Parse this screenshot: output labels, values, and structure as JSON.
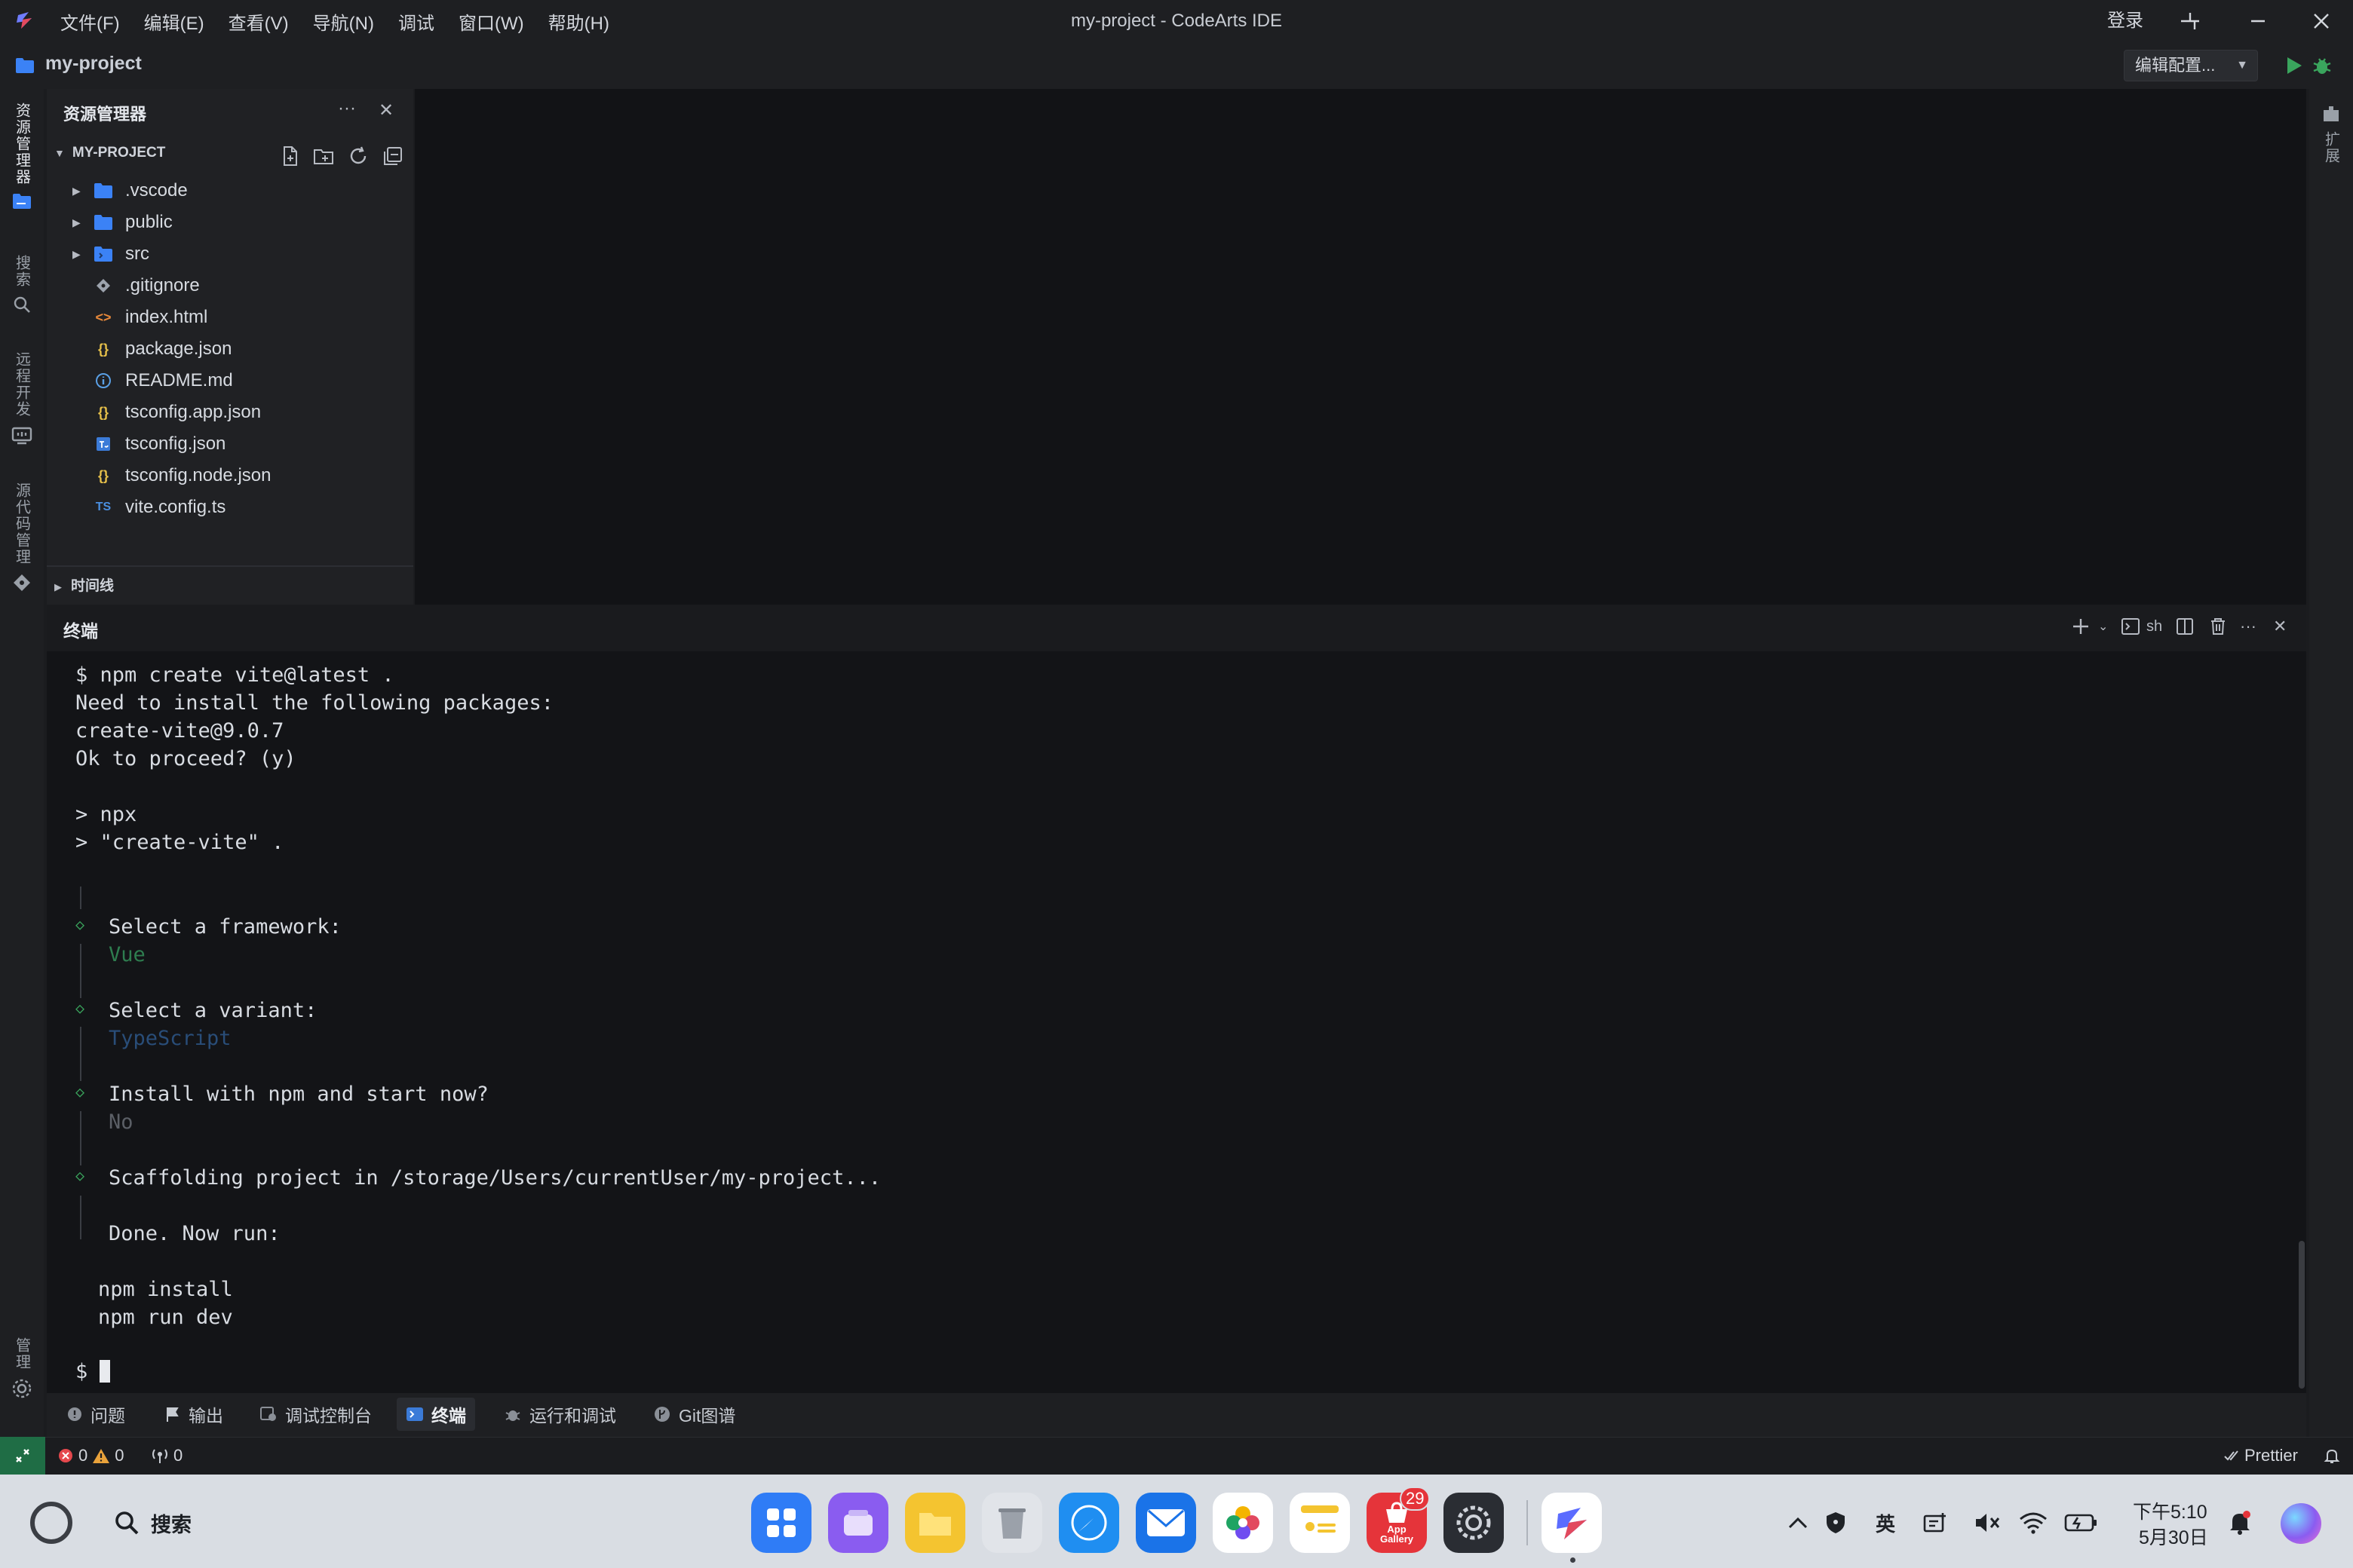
{
  "titlebar": {
    "menu": [
      "文件(F)",
      "编辑(E)",
      "查看(V)",
      "导航(N)",
      "调试",
      "窗口(W)",
      "帮助(H)"
    ],
    "title": "my-project - CodeArts IDE",
    "login": "登录"
  },
  "projectbar": {
    "project_name": "my-project",
    "run_config": "编辑配置..."
  },
  "activity_left": {
    "explorer": "资源管理器",
    "search": "搜索",
    "remote": "远程开发",
    "scm": "源代码管理",
    "manage": "管理"
  },
  "activity_right": {
    "extensions": "扩展"
  },
  "explorer": {
    "title": "资源管理器",
    "project_header": "MY-PROJECT",
    "items": [
      {
        "name": ".vscode",
        "kind": "folder",
        "icon": "folder-icon"
      },
      {
        "name": "public",
        "kind": "folder",
        "icon": "folder-icon"
      },
      {
        "name": "src",
        "kind": "folder",
        "icon": "src-folder-icon"
      },
      {
        "name": ".gitignore",
        "kind": "file",
        "icon": "git-icon"
      },
      {
        "name": "index.html",
        "kind": "file",
        "icon": "html-icon"
      },
      {
        "name": "package.json",
        "kind": "file",
        "icon": "json-icon"
      },
      {
        "name": "README.md",
        "kind": "file",
        "icon": "info-icon"
      },
      {
        "name": "tsconfig.app.json",
        "kind": "file",
        "icon": "json-icon"
      },
      {
        "name": "tsconfig.json",
        "kind": "file",
        "icon": "tsconfig-icon"
      },
      {
        "name": "tsconfig.node.json",
        "kind": "file",
        "icon": "json-icon"
      },
      {
        "name": "vite.config.ts",
        "kind": "file",
        "icon": "ts-icon"
      }
    ],
    "timeline": "时间线"
  },
  "panel": {
    "title": "终端",
    "shell": "sh"
  },
  "terminal": {
    "lines": [
      "$ npm create vite@latest .",
      "Need to install the following packages:",
      "create-vite@9.0.7",
      "Ok to proceed? (y)",
      "> npx",
      "> \"create-vite\" .",
      "Select a framework:",
      "Vue",
      "Select a variant:",
      "TypeScript",
      "Install with npm and start now?",
      "No",
      "Scaffolding project in /storage/Users/currentUser/my-project...",
      "Done. Now run:",
      "npm install",
      "npm run dev",
      "$"
    ]
  },
  "bottom_tabs": [
    "问题",
    "输出",
    "调试控制台",
    "终端",
    "运行和调试",
    "Git图谱"
  ],
  "statusbar": {
    "errors": "0",
    "warnings": "0",
    "ports": "0",
    "prettier": "Prettier"
  },
  "taskbar": {
    "search": "搜索",
    "badge_count": "29",
    "app_gallery": "App Gallery",
    "ime": "英",
    "time": "下午5:10",
    "date": "5月30日"
  },
  "colors": {
    "accent_green": "#3aa55d",
    "folder_blue": "#3b82f6",
    "json_yellow": "#e6c04a",
    "remote_green": "#1f6d45",
    "badge_red": "#e5343a"
  }
}
